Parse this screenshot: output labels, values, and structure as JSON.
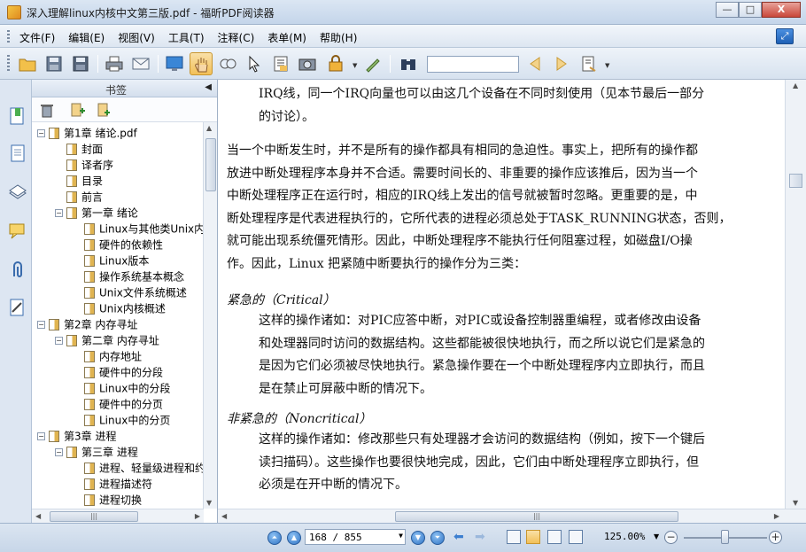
{
  "window": {
    "title": "深入理解linux内核中文第三版.pdf - 福昕PDF阅读器",
    "minimize": "—",
    "maximize": "□",
    "close": "X"
  },
  "menu": {
    "items": [
      "文件(F)",
      "编辑(E)",
      "视图(V)",
      "工具(T)",
      "注释(C)",
      "表单(M)",
      "帮助(H)"
    ]
  },
  "toolbar": {
    "search_value": ""
  },
  "bookmarks": {
    "title": "书签",
    "collapse": "◀",
    "tree": [
      {
        "label": "第1章 绪论.pdf",
        "depth": 0,
        "toggle": "−"
      },
      {
        "label": "封面",
        "depth": 1
      },
      {
        "label": "译者序",
        "depth": 1
      },
      {
        "label": "目录",
        "depth": 1
      },
      {
        "label": "前言",
        "depth": 1
      },
      {
        "label": "第一章 绪论",
        "depth": 1,
        "toggle": "−"
      },
      {
        "label": "Linux与其他类Unix内",
        "depth": 2
      },
      {
        "label": "硬件的依赖性",
        "depth": 2
      },
      {
        "label": "Linux版本",
        "depth": 2
      },
      {
        "label": "操作系统基本概念",
        "depth": 2
      },
      {
        "label": "Unix文件系统概述",
        "depth": 2
      },
      {
        "label": "Unix内核概述",
        "depth": 2
      },
      {
        "label": "第2章 内存寻址",
        "depth": 0,
        "toggle": "−"
      },
      {
        "label": "第二章 内存寻址",
        "depth": 1,
        "toggle": "−"
      },
      {
        "label": "内存地址",
        "depth": 2
      },
      {
        "label": "硬件中的分段",
        "depth": 2
      },
      {
        "label": "Linux中的分段",
        "depth": 2
      },
      {
        "label": "硬件中的分页",
        "depth": 2
      },
      {
        "label": "Linux中的分页",
        "depth": 2
      },
      {
        "label": "第3章 进程",
        "depth": 0,
        "toggle": "−"
      },
      {
        "label": "第三章 进程",
        "depth": 1,
        "toggle": "−"
      },
      {
        "label": "进程、轻量级进程和约",
        "depth": 2
      },
      {
        "label": "进程描述符",
        "depth": 2
      },
      {
        "label": "进程切换",
        "depth": 2
      }
    ]
  },
  "document": {
    "p1_lines": [
      "IRQ线，同一个IRQ向量也可以由这几个设备在不同时刻使用（见本节最后一部分",
      "的讨论）。"
    ],
    "p2_lines": [
      "当一个中断发生时，并不是所有的操作都具有相同的急迫性。事实上，把所有的操作都",
      "放进中断处理程序本身并不合适。需要时间长的、非重要的操作应该推后，因为当一个",
      "中断处理程序正在运行时，相应的IRQ线上发出的信号就被暂时忽略。更重要的是，中",
      "断处理程序是代表进程执行的，它所代表的进程必须总处于TASK_RUNNING状态，否则，",
      "就可能出现系统僵死情形。因此，中断处理程序不能执行任何阻塞过程，如磁盘I/O操",
      "作。因此，Linux 把紧随中断要执行的操作分为三类："
    ],
    "h1": "紧急的（Critical）",
    "p3_lines": [
      "这样的操作诸如：对PIC应答中断，对PIC或设备控制器重编程，或者修改由设备",
      "和处理器同时访问的数据结构。这些都能被很快地执行，而之所以说它们是紧急的",
      "是因为它们必须被尽快地执行。紧急操作要在一个中断处理程序内立即执行，而且",
      "是在禁止可屏蔽中断的情况下。"
    ],
    "h2": "非紧急的（Noncritical）",
    "p4_lines": [
      "这样的操作诸如：修改那些只有处理器才会访问的数据结构（例如，按下一个键后",
      "读扫描码）。这些操作也要很快地完成，因此，它们由中断处理程序立即执行，但",
      "必须是在开中断的情况下。"
    ]
  },
  "status": {
    "page_display": "168 / 855",
    "current_page": 168,
    "total_pages": 855,
    "zoom": "125.00%",
    "zoom_level_fraction": 0.5
  },
  "colors": {
    "title_bar": "#c4d5ea",
    "toolbar": "#d7e2ef",
    "active_tool": "#f2c058",
    "nav_blue": "#2f73c4"
  }
}
